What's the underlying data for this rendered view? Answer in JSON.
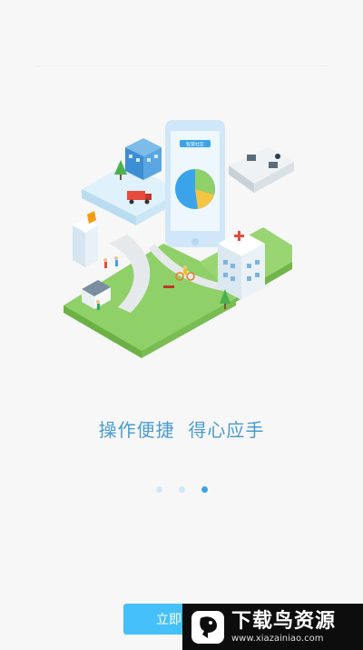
{
  "intro": {
    "slogan": "操作便捷  得心应手",
    "phone_screen_label": "智慧社区",
    "pages": [
      {
        "active": false
      },
      {
        "active": false
      },
      {
        "active": true
      }
    ],
    "start_button_label": "立即"
  },
  "watermark": {
    "title": "下载鸟资源",
    "url": "www.xiazainiao.com"
  },
  "colors": {
    "accent": "#3aa3ea",
    "button": "#45c0f8",
    "grass": "#8fd068",
    "background": "#f7f7f7"
  }
}
